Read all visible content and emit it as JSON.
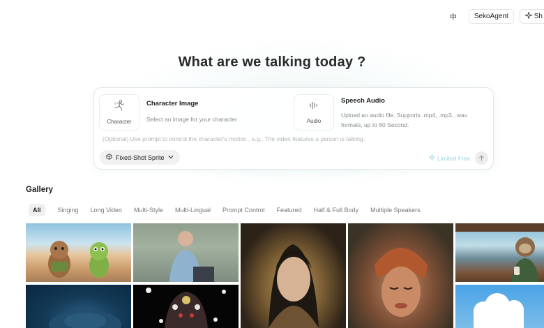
{
  "topbar": {
    "language_icon_text": "中",
    "seko_agent_label": "SekoAgent",
    "share_label_visible": "Sh"
  },
  "hero": {
    "title": "What are we talking today ?"
  },
  "inputs": {
    "character": {
      "slot_label": "Character",
      "heading": "Character Image",
      "description": "Select an image for your character"
    },
    "audio": {
      "slot_label": "Audio",
      "heading": "Speech Audio",
      "description": "Upload an audio file. Supports .mp4, .mp3, .wav formats, up to 60 Second."
    },
    "prompt_placeholder": "(Optional)  Use prompt to control the character's motion , e.g., The video features a person is talking.",
    "mode_label": "Fixed-Shot Sprite",
    "limited_label": "Limited Free"
  },
  "gallery": {
    "title": "Gallery",
    "filters": [
      "All",
      "Singing",
      "Long Video",
      "Multi-Style",
      "Multi-Lingual",
      "Prompt Control",
      "Featured",
      "Half & Full Body",
      "Multiple Speakers"
    ],
    "active_filter": "All"
  },
  "colors": {
    "limited_accent": "#9cd3e3",
    "active_chip_bg": "#efefef"
  }
}
